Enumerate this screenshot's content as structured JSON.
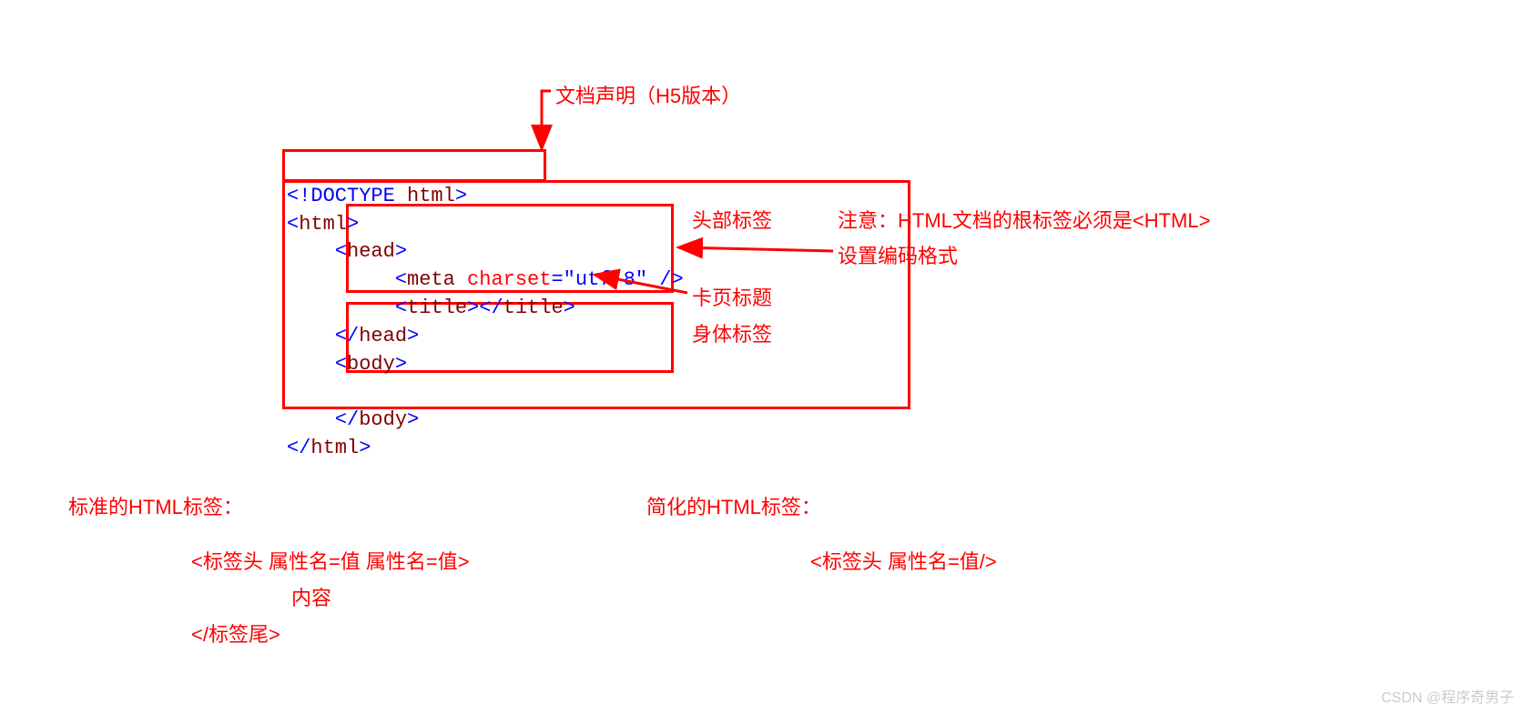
{
  "code": {
    "line1": "<!DOCTYPE html>",
    "line2": "<html>",
    "line3": "    <head>",
    "line4": "         <meta charset=\"utf-8\" />",
    "line5": "         <title></title>",
    "line6": "    </head>",
    "line7": "    <body>",
    "line8": "",
    "line9": "    </body>",
    "line10": "</html>"
  },
  "labels": {
    "doctype": "文档声明（H5版本）",
    "head": "头部标签",
    "charset": "设置编码格式",
    "title": "卡页标题",
    "body": "身体标签",
    "note": "注意：HTML文档的根标签必须是<HTML>"
  },
  "standard": {
    "title": "标准的HTML标签：",
    "line1": "<标签头 属性名=值 属性名=值>",
    "line2": "内容",
    "line3": "</标签尾>"
  },
  "simple": {
    "title": "简化的HTML标签：",
    "line1": "<标签头 属性名=值/>"
  },
  "watermark": "CSDN @程序奇男子"
}
